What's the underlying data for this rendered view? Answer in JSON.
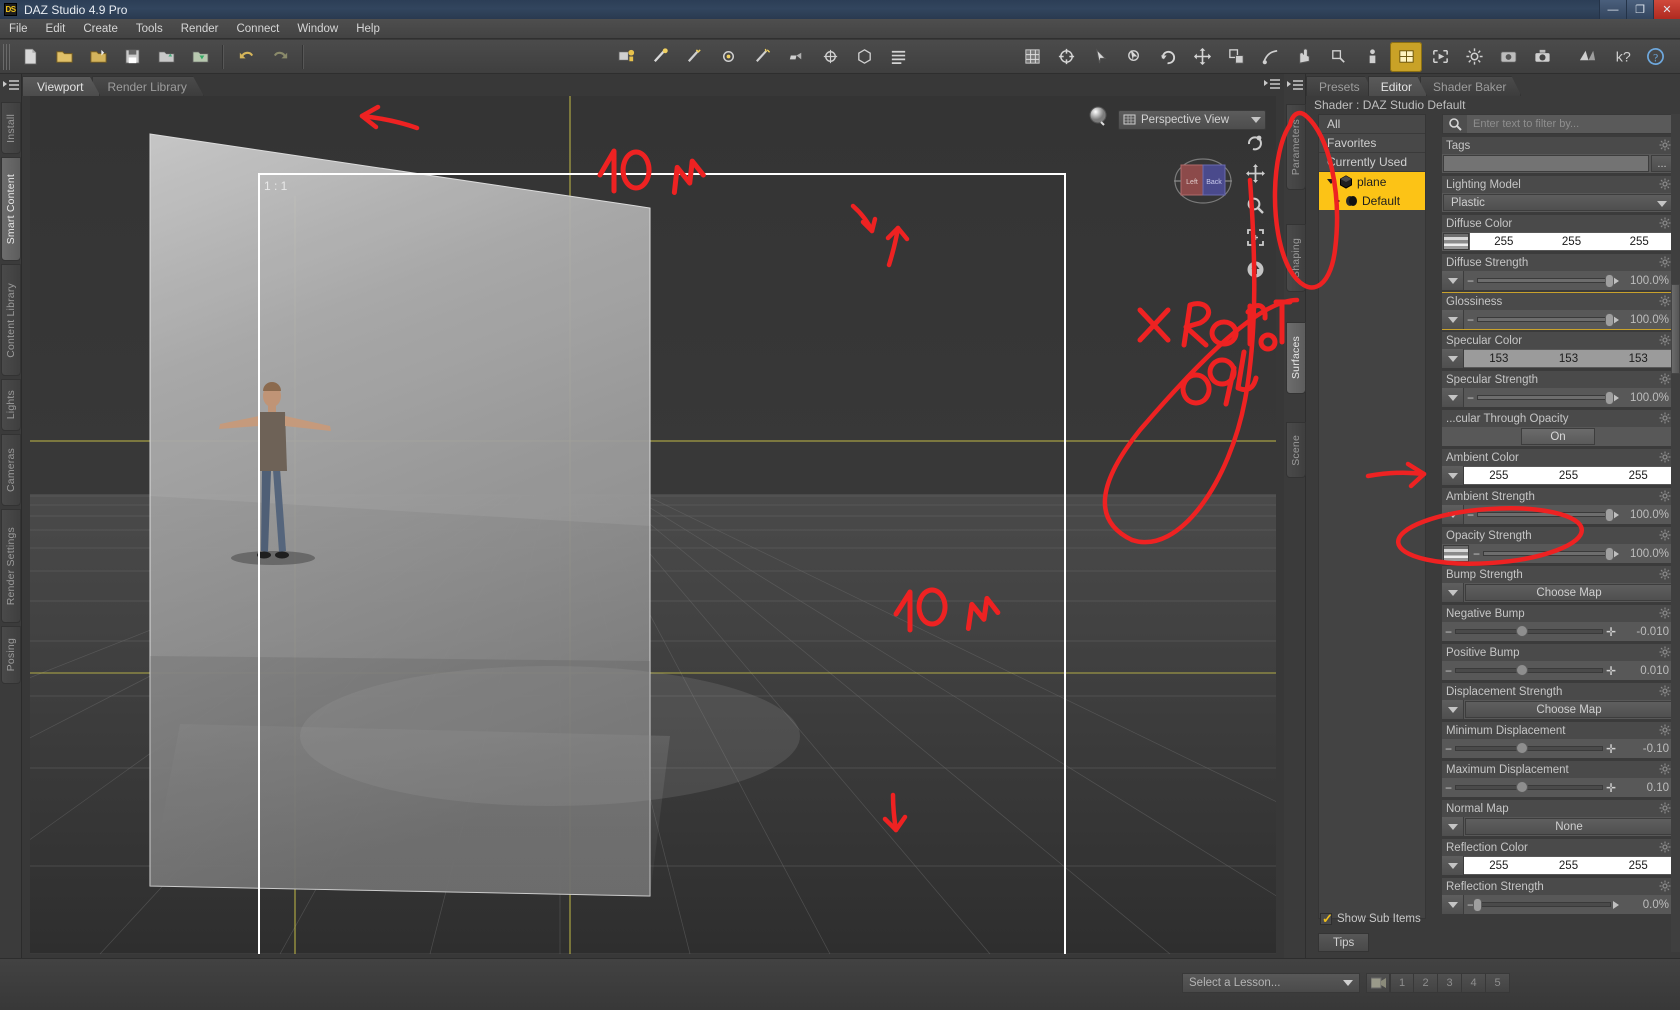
{
  "window": {
    "title": "DAZ Studio 4.9 Pro",
    "logo": "DS",
    "minimize": "—",
    "maximize": "❐",
    "close": "✕"
  },
  "menu": {
    "items": [
      "File",
      "Edit",
      "Create",
      "Tools",
      "Render",
      "Connect",
      "Window",
      "Help"
    ]
  },
  "toolbar": {
    "icons": [
      "add-figure-icon",
      "light-icon",
      "spot-light-icon",
      "point-light-icon",
      "distant-light-icon",
      "camera-add-icon",
      "null-node-icon",
      "primitive-icon",
      "list-icon",
      "grid-snap-icon",
      "universal-tool-icon",
      "node-select-icon",
      "region-select-icon",
      "rotate-tool-icon",
      "translate-tool-icon",
      "scale-tool-icon",
      "push-tool-icon",
      "activepose-tool-icon",
      "mesh-grab-icon",
      "node-transform-icon",
      "figure-setup-icon",
      "surface-select-icon",
      "spot-render-icon",
      "render-settings-icon",
      "render-icon",
      "render-camera-icon"
    ],
    "right_icons": [
      "daz-connect-icon",
      "help-question-icon",
      "help-info-icon"
    ]
  },
  "left_tabs": {
    "items": [
      "Install",
      "Smart Content",
      "Content Library",
      "Lights",
      "Cameras",
      "Render Settings",
      "Posing"
    ],
    "selected": "Smart Content"
  },
  "viewport": {
    "tabs": [
      {
        "label": "Viewport",
        "selected": true
      },
      {
        "label": "Render Library",
        "selected": false
      }
    ],
    "aspect_ratio": "1 : 1",
    "view_mode": "Perspective View",
    "cube_faces": {
      "left": "Left",
      "back": "Back"
    },
    "nav_icons": [
      "orbit-icon",
      "pan-icon",
      "zoom-icon",
      "frame-icon",
      "reset-icon"
    ]
  },
  "right_dock": {
    "vertical_tabs": [
      "Parameters",
      "Shaping",
      "Surfaces",
      "Scene"
    ],
    "selected_vertical_tab": "Surfaces",
    "tabs": [
      {
        "label": "Presets",
        "selected": false
      },
      {
        "label": "Editor",
        "selected": true
      },
      {
        "label": "Shader Baker",
        "selected": false
      }
    ],
    "shader_title": "Shader : DAZ Studio Default",
    "tree": [
      {
        "label": "All",
        "selected": false,
        "indent": 0
      },
      {
        "label": "Favorites",
        "selected": false,
        "indent": 0
      },
      {
        "label": "Currently Used",
        "selected": false,
        "indent": 0
      },
      {
        "label": "plane",
        "selected": true,
        "indent": 0,
        "icon": "cube-icon",
        "arrow": "down"
      },
      {
        "label": "Default",
        "selected": true,
        "indent": 1,
        "icon": "surface-icon",
        "arrow": "right"
      }
    ],
    "show_sub_items": "Show Sub Items",
    "tips_tab": "Tips",
    "search": {
      "placeholder": "Enter text to filter by...",
      "icon": "search-icon"
    },
    "properties": [
      {
        "name": "Tags",
        "type": "tags",
        "value": "",
        "highlighted": false
      },
      {
        "name": "Lighting Model",
        "type": "select",
        "value": "Plastic",
        "highlighted": false
      },
      {
        "name": "Diffuse Color",
        "type": "color-map",
        "value": [
          "255",
          "255",
          "255"
        ],
        "highlighted": false
      },
      {
        "name": "Diffuse Strength",
        "type": "slider",
        "value": "100.0%",
        "percent": 100,
        "highlighted": false
      },
      {
        "name": "Glossiness",
        "type": "slider",
        "value": "100.0%",
        "percent": 100,
        "highlighted": true
      },
      {
        "name": "Specular Color",
        "type": "color",
        "value": [
          "153",
          "153",
          "153"
        ],
        "grey": true,
        "highlighted": false
      },
      {
        "name": "Specular Strength",
        "type": "slider",
        "value": "100.0%",
        "percent": 100,
        "highlighted": false
      },
      {
        "name": "...cular Through Opacity",
        "type": "toggle",
        "value": "On",
        "highlighted": false
      },
      {
        "name": "Ambient Color",
        "type": "color",
        "value": [
          "255",
          "255",
          "255"
        ],
        "highlighted": false
      },
      {
        "name": "Ambient Strength",
        "type": "slider",
        "value": "100.0%",
        "percent": 100,
        "highlighted": false
      },
      {
        "name": "Opacity Strength",
        "type": "slider-map",
        "value": "100.0%",
        "percent": 100,
        "highlighted": false
      },
      {
        "name": "Bump Strength",
        "type": "button",
        "value": "Choose Map",
        "highlighted": false
      },
      {
        "name": "Negative Bump",
        "type": "stepper",
        "value": "-0.010",
        "percent": 45,
        "highlighted": false
      },
      {
        "name": "Positive Bump",
        "type": "stepper",
        "value": "0.010",
        "percent": 45,
        "highlighted": false
      },
      {
        "name": "Displacement Strength",
        "type": "button",
        "value": "Choose Map",
        "highlighted": false
      },
      {
        "name": "Minimum Displacement",
        "type": "stepper",
        "value": "-0.10",
        "percent": 45,
        "highlighted": false
      },
      {
        "name": "Maximum Displacement",
        "type": "stepper",
        "value": "0.10",
        "percent": 45,
        "highlighted": false
      },
      {
        "name": "Normal Map",
        "type": "button",
        "value": "None",
        "highlighted": false
      },
      {
        "name": "Reflection Color",
        "type": "color",
        "value": [
          "255",
          "255",
          "255"
        ],
        "highlighted": false
      },
      {
        "name": "Reflection Strength",
        "type": "slider",
        "value": "0.0%",
        "percent": 0,
        "highlighted": false
      }
    ]
  },
  "status_bar": {
    "lesson_select": "Select a Lesson...",
    "lesson_buttons": [
      "1",
      "2",
      "3",
      "4",
      "5"
    ],
    "video_icon": "video-icon"
  },
  "annotations": {
    "top_label": "10 m",
    "bottom_label": "10 m",
    "rotate_label_line1": "x Rotate",
    "rotate_label_line2": "90°",
    "color": "#ee2222"
  }
}
